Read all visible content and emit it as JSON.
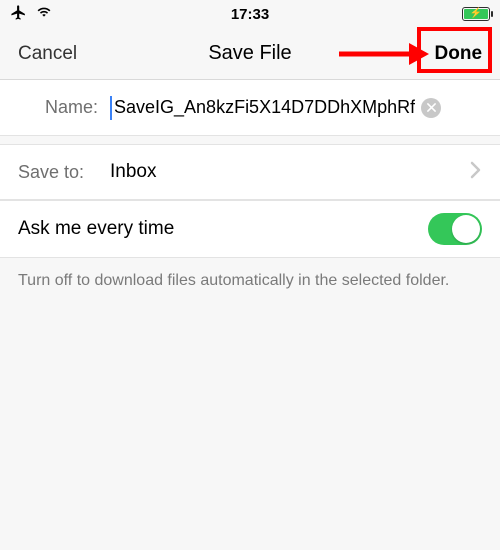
{
  "status": {
    "time": "17:33"
  },
  "nav": {
    "cancel": "Cancel",
    "title": "Save File",
    "done": "Done"
  },
  "fields": {
    "name_label": "Name:",
    "name_value": "SaveIG_An8kzFi5X14D7DDhXMphRf",
    "saveto_label": "Save to:",
    "saveto_value": "Inbox",
    "toggle_label": "Ask me every time",
    "toggle_on": true
  },
  "caption": "Turn off to download files automatically in the selected folder."
}
